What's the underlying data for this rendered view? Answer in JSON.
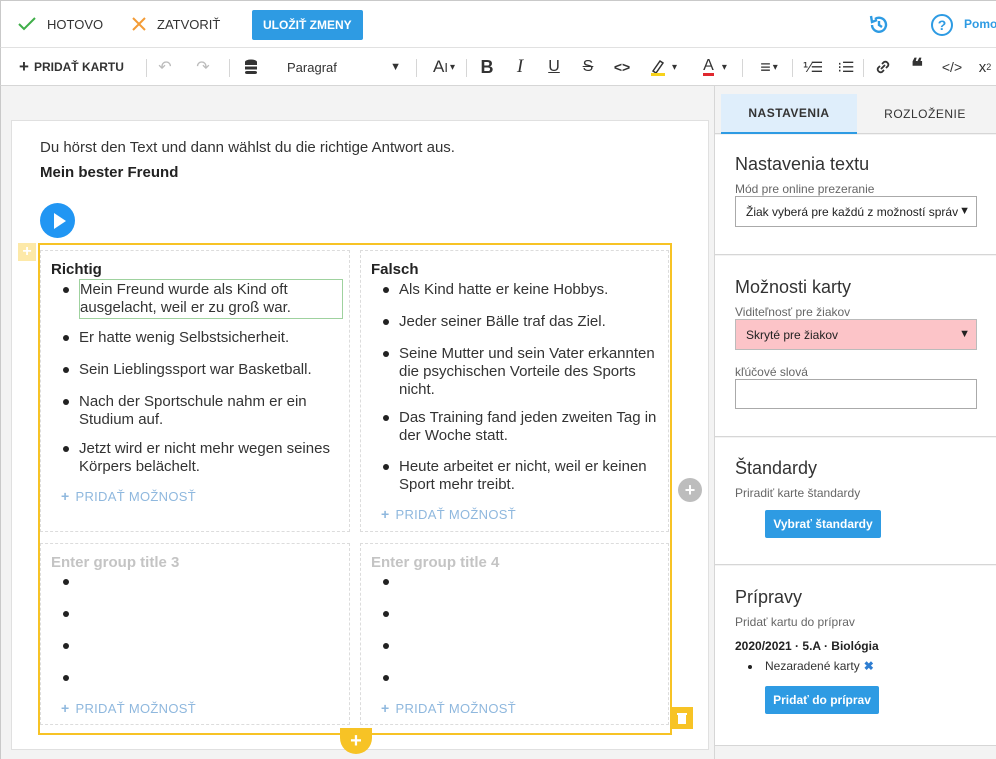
{
  "topbar": {
    "done_label": "HOTOVO",
    "close_label": "ZATVORIŤ",
    "save_label": "ULOŽIŤ ZMENY",
    "help_label": "Pomo"
  },
  "toolbar": {
    "add_card_label": "PRIDAŤ KARTU",
    "paragraph_value": "Paragraf",
    "icons": [
      "undo-icon",
      "redo-icon",
      "database-icon",
      "font-size-icon",
      "bold-icon",
      "italic-icon",
      "underline-icon",
      "strikethrough-icon",
      "code-icon",
      "highlight-icon",
      "font-color-icon",
      "align-icon",
      "numbered-list-icon",
      "bullet-list-icon",
      "link-icon",
      "quote-icon",
      "html-icon",
      "superscript-icon"
    ]
  },
  "content": {
    "instruction": "Du hörst den Text und dann wählst du die richtige Antwort aus.",
    "title": "Mein bester Freund",
    "groups": [
      {
        "title": "Richtig",
        "items": [
          "Mein Freund wurde als Kind oft ausgelacht, weil er zu groß war.",
          "Er hatte wenig Selbstsicherheit.",
          "Sein Lieblingssport war Basketball.",
          "Nach der Sportschule nahm er ein Studium auf.",
          "Jetzt wird er nicht mehr wegen seines Körpers belächelt."
        ],
        "add_label": "PRIDAŤ MOŽNOSŤ"
      },
      {
        "title": "Falsch",
        "items": [
          "Als Kind hatte er keine Hobbys.",
          "Jeder seiner Bälle traf das Ziel.",
          "Seine Mutter und sein Vater erkannten die psychischen Vorteile des Sports nicht.",
          "Das Training fand jeden zweiten Tag in der Woche statt.",
          "Heute arbeitet er nicht, weil er keinen Sport mehr treibt."
        ],
        "add_label": "PRIDAŤ MOŽNOSŤ"
      },
      {
        "title": "Enter group title 3",
        "items": [
          "",
          "",
          "",
          ""
        ],
        "add_label": "PRIDAŤ MOŽNOSŤ"
      },
      {
        "title": "Enter group title 4",
        "items": [
          "",
          "",
          "",
          ""
        ],
        "add_label": "PRIDAŤ MOŽNOSŤ"
      }
    ]
  },
  "panel": {
    "tabs": [
      "NASTAVENIA",
      "ROZLOŽENIE"
    ],
    "text_settings": {
      "title": "Nastavenia textu",
      "mode_label": "Mód pre online prezeranie",
      "mode_value": "Žiak vyberá pre každú z možností správ"
    },
    "card_options": {
      "title": "Možnosti karty",
      "visibility_label": "Viditeľnosť pre žiakov",
      "visibility_value": "Skryté pre žiakov",
      "keywords_label": "kľúčové slová",
      "keywords_value": ""
    },
    "standards": {
      "title": "Štandardy",
      "label": "Priradiť karte štandardy",
      "button": "Vybrať štandardy"
    },
    "preps": {
      "title": "Prípravy",
      "label": "Pridať kartu do príprav",
      "class_line": "2020/2021 · 5.A · Biológia",
      "item": "Nezaradené karty",
      "button": "Pridať do príprav"
    }
  }
}
